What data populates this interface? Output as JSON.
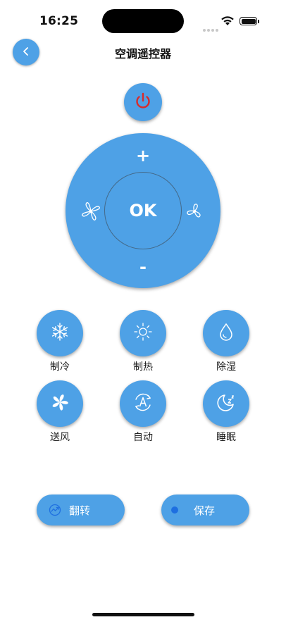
{
  "status_bar": {
    "time": "16:25"
  },
  "header": {
    "title": "空调遥控器",
    "back_icon": "chevron-left-icon"
  },
  "power": {
    "icon": "power-icon",
    "color": "#d92a2a"
  },
  "dial": {
    "ok_label": "OK",
    "plus_label": "+",
    "minus_label": "-",
    "left_icon": "fan-icon",
    "right_icon": "fan-icon"
  },
  "modes": [
    {
      "label": "制冷",
      "icon": "snowflake-icon"
    },
    {
      "label": "制热",
      "icon": "sun-icon"
    },
    {
      "label": "除湿",
      "icon": "water-drop-icon"
    },
    {
      "label": "送风",
      "icon": "pinwheel-icon"
    },
    {
      "label": "自动",
      "icon": "auto-icon"
    },
    {
      "label": "睡眠",
      "icon": "moon-icon"
    }
  ],
  "actions": {
    "flip_label": "翻转",
    "save_label": "保存"
  },
  "colors": {
    "accent": "#4ea1e6",
    "power_red": "#d92a2a",
    "dot_blue": "#1e6fe0"
  }
}
